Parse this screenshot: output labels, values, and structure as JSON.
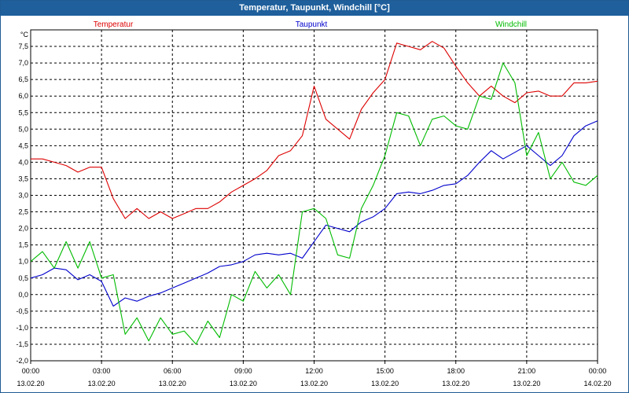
{
  "window": {
    "title": "Temperatur, Taupunkt, Windchill [°C]"
  },
  "colors": {
    "title_bg": "#1e5f9c",
    "grid": "#000000"
  },
  "chart_data": {
    "type": "line",
    "title": "Temperatur, Taupunkt, Windchill [°C]",
    "ylabel": "°C",
    "xlabel": "",
    "ylim": [
      -2.0,
      8.0
    ],
    "grid": true,
    "legend": "top",
    "y_ticks": [
      "7,5",
      "7,0",
      "6,5",
      "6,0",
      "5,5",
      "5,0",
      "4,5",
      "4,0",
      "3,5",
      "3,0",
      "2,5",
      "2,0",
      "1,5",
      "1,0",
      "0,5",
      "0,0",
      "-0,5",
      "-1,0",
      "-1,5",
      "-2,0"
    ],
    "x_ticks": [
      {
        "time": "00:00",
        "date": "13.02.20"
      },
      {
        "time": "03:00",
        "date": "13.02.20"
      },
      {
        "time": "06:00",
        "date": "13.02.20"
      },
      {
        "time": "09:00",
        "date": "13.02.20"
      },
      {
        "time": "12:00",
        "date": "13.02.20"
      },
      {
        "time": "15:00",
        "date": "13.02.20"
      },
      {
        "time": "18:00",
        "date": "13.02.20"
      },
      {
        "time": "21:00",
        "date": "13.02.20"
      },
      {
        "time": "00:00",
        "date": "14.02.20"
      }
    ],
    "x": [
      0,
      0.5,
      1,
      1.5,
      2,
      2.5,
      3,
      3.5,
      4,
      4.5,
      5,
      5.5,
      6,
      6.5,
      7,
      7.5,
      8,
      8.5,
      9,
      9.5,
      10,
      10.5,
      11,
      11.5,
      12,
      12.5,
      13,
      13.5,
      14,
      14.5,
      15,
      15.5,
      16,
      16.5,
      17,
      17.5,
      18,
      18.5,
      19,
      19.5,
      20,
      20.5,
      21,
      21.5,
      22,
      22.5,
      23,
      23.5,
      24
    ],
    "series": [
      {
        "name": "Temperatur",
        "color": "#dd0000",
        "values": [
          4.1,
          4.1,
          4.0,
          3.9,
          3.7,
          3.85,
          3.85,
          2.9,
          2.3,
          2.6,
          2.3,
          2.5,
          2.3,
          2.45,
          2.6,
          2.6,
          2.8,
          3.1,
          3.3,
          3.5,
          3.75,
          4.2,
          4.35,
          4.8,
          6.3,
          5.3,
          5.0,
          4.7,
          5.6,
          6.1,
          6.5,
          7.6,
          7.5,
          7.4,
          7.65,
          7.45,
          6.9,
          6.4,
          6.0,
          6.3,
          6.0,
          5.8,
          6.1,
          6.15,
          6.0,
          6.0,
          6.4,
          6.4,
          6.45
        ]
      },
      {
        "name": "Taupunkt",
        "color": "#0000cc",
        "values": [
          0.5,
          0.6,
          0.8,
          0.75,
          0.45,
          0.6,
          0.4,
          -0.35,
          -0.1,
          -0.2,
          -0.05,
          0.05,
          0.2,
          0.35,
          0.5,
          0.65,
          0.85,
          0.9,
          1.0,
          1.2,
          1.25,
          1.2,
          1.25,
          1.1,
          1.6,
          2.1,
          2.0,
          1.9,
          2.2,
          2.35,
          2.6,
          3.05,
          3.1,
          3.05,
          3.15,
          3.3,
          3.35,
          3.6,
          4.0,
          4.35,
          4.1,
          4.3,
          4.5,
          4.2,
          3.9,
          4.2,
          4.8,
          5.1,
          5.25
        ]
      },
      {
        "name": "Windchill",
        "color": "#00bb00",
        "values": [
          1.0,
          1.3,
          0.8,
          1.6,
          0.8,
          1.6,
          0.5,
          0.6,
          -1.2,
          -0.7,
          -1.4,
          -0.7,
          -1.2,
          -1.1,
          -1.5,
          -0.8,
          -1.3,
          0.0,
          -0.2,
          0.7,
          0.2,
          0.6,
          0.0,
          2.5,
          2.6,
          2.3,
          1.2,
          1.1,
          2.6,
          3.3,
          4.2,
          5.5,
          5.4,
          4.5,
          5.3,
          5.4,
          5.1,
          5.0,
          6.0,
          5.9,
          7.0,
          6.4,
          4.2,
          4.9,
          3.5,
          4.0,
          3.4,
          3.3,
          3.6
        ]
      }
    ]
  }
}
